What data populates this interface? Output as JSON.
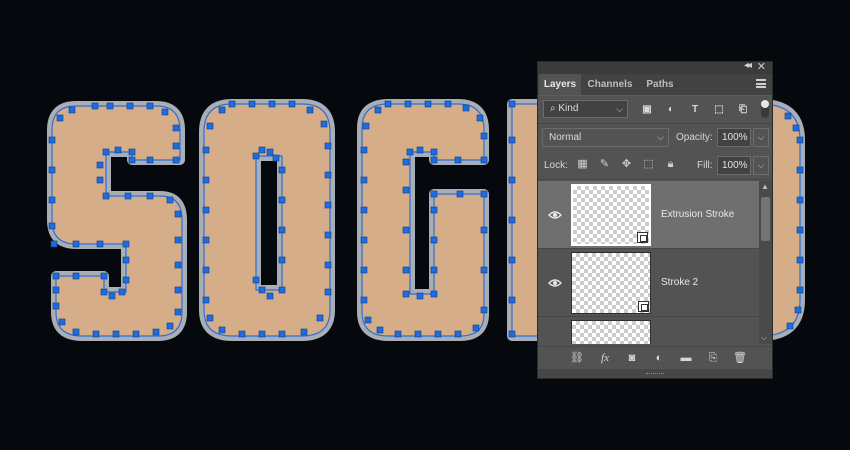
{
  "canvas": {
    "background": "#05080d",
    "text_fill": "#d6ad89",
    "stroke_color": "#a9aeb4",
    "path_color": "#2f6fd6",
    "anchor_color": "#1e6de0"
  },
  "panel": {
    "tabs": [
      {
        "label": "Layers",
        "active": true
      },
      {
        "label": "Channels",
        "active": false
      },
      {
        "label": "Paths",
        "active": false
      }
    ],
    "filter": {
      "kind_label": "Kind",
      "icons": [
        "pixel-filter-icon",
        "adjustment-filter-icon",
        "type-filter-icon",
        "shape-filter-icon",
        "smart-object-filter-icon"
      ]
    },
    "blend_mode": "Normal",
    "opacity_label": "Opacity:",
    "opacity_value": "100%",
    "lock_label": "Lock:",
    "fill_label": "Fill:",
    "fill_value": "100%",
    "layers": [
      {
        "name": "Extrusion Stroke",
        "visible": true,
        "selected": true,
        "smart_object": true
      },
      {
        "name": "Stroke 2",
        "visible": true,
        "selected": false,
        "smart_object": true
      },
      {
        "name": "",
        "visible": true,
        "selected": false,
        "smart_object": false
      }
    ],
    "bottom_icons": [
      "link-layers-icon",
      "fx-icon",
      "add-mask-icon",
      "new-adjustment-icon",
      "new-group-icon",
      "new-layer-icon",
      "delete-layer-icon"
    ]
  }
}
